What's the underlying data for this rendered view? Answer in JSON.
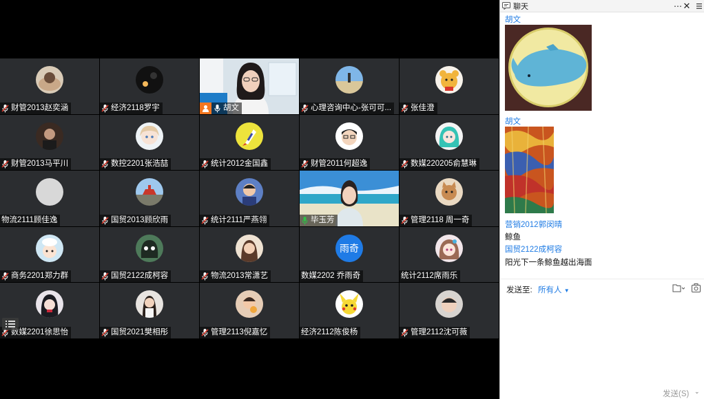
{
  "participants": [
    {
      "name": "财管2013赵奕涵",
      "mic": "muted",
      "avatar": "photo-sleeping"
    },
    {
      "name": "经济2118罗宇",
      "mic": "muted",
      "avatar": "photo-dark"
    },
    {
      "name": "胡文",
      "mic": "on",
      "host": true,
      "avatar": "video"
    },
    {
      "name": "心理咨询中心-张可可...",
      "mic": "muted",
      "avatar": "photo-beach-figure"
    },
    {
      "name": "张佳澄",
      "mic": "muted",
      "avatar": "cartoon-bear"
    },
    {
      "name": "财管2013马平川",
      "mic": "muted",
      "avatar": "photo-portrait-dark"
    },
    {
      "name": "数控2201张浩喆",
      "mic": "muted",
      "avatar": "anime-girl"
    },
    {
      "name": "统计2012金国鑫",
      "mic": "muted",
      "avatar": "rocket-logo"
    },
    {
      "name": "财管2011何超逸",
      "mic": "muted",
      "avatar": "cartoon-face-glasses"
    },
    {
      "name": "数媒220205俞慧琳",
      "mic": "muted",
      "avatar": "anime-green-hair"
    },
    {
      "name": "物流2111顾佳逸",
      "mic": "none",
      "avatar": "gray-circle"
    },
    {
      "name": "国贸2013顾欣雨",
      "mic": "muted",
      "avatar": "photo-landmark"
    },
    {
      "name": "统计2111严燕翎",
      "mic": "muted",
      "avatar": "photo-child"
    },
    {
      "name": "毕玉芳",
      "mic": "speaking",
      "avatar": "video-beach"
    },
    {
      "name": "管理2118 周一奇",
      "mic": "muted",
      "avatar": "cartoon-cat"
    },
    {
      "name": "商务2201郑力群",
      "mic": "muted",
      "avatar": "cartoon-chef"
    },
    {
      "name": "国贸2122成柯容",
      "mic": "muted",
      "avatar": "cartoon-ghost"
    },
    {
      "name": "物流2013常潇艺",
      "mic": "muted",
      "avatar": "photo-girl"
    },
    {
      "name": "数媒2202 乔雨奇",
      "mic": "none",
      "avatar": "text",
      "avatar_text": "雨奇"
    },
    {
      "name": "统计2112席雨乐",
      "mic": "none",
      "avatar": "anime-girl-colorful"
    },
    {
      "name": "数媒2201徐思怡",
      "mic": "muted",
      "avatar": "anime-dark"
    },
    {
      "name": "国贸2021樊相彤",
      "mic": "muted",
      "avatar": "photo-woman"
    },
    {
      "name": "管理2113倪嘉忆",
      "mic": "muted",
      "avatar": "photo-eating"
    },
    {
      "name": "经济2112陈俊杨",
      "mic": "none",
      "avatar": "pikachu"
    },
    {
      "name": "管理2112沈可薇",
      "mic": "muted",
      "avatar": "photo-face"
    }
  ],
  "chat": {
    "title": "聊天",
    "messages": [
      {
        "sender": "胡文",
        "type": "image",
        "image": "whale-drawing"
      },
      {
        "sender": "胡文",
        "type": "image",
        "image": "abstract-painting"
      },
      {
        "sender": "营销2012郭闵晴",
        "text": "鲸鱼"
      },
      {
        "sender": "国贸2122成柯容",
        "text": "阳光下一条鲸鱼越出海面"
      }
    ],
    "send_to_label": "发送至:",
    "recipient": "所有人",
    "send_label": "发送(S)",
    "composer_placeholder": ""
  },
  "colors": {
    "accent_blue": "#1e7be4",
    "tile_bg": "#2b2d30",
    "host_badge": "#f2761f",
    "mic_muted_red": "#d33a2c",
    "mic_speaking_green": "#2fbf46"
  }
}
